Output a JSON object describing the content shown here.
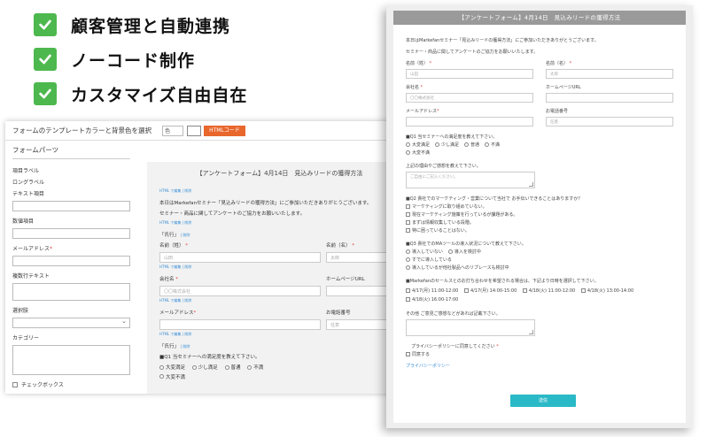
{
  "features": [
    {
      "label": "顧客管理と自動連携"
    },
    {
      "label": "ノーコード制作"
    },
    {
      "label": "カスタマイズ自由自在"
    }
  ],
  "colors": {
    "check": "#4db84d",
    "accent_orange": "#e8672c",
    "submit": "#2ab9c7",
    "header_gray": "#9a9a9a",
    "link": "#3a8fd6"
  },
  "editor": {
    "toolbar_label": "フォームのテンプレートカラーと背景色を選択",
    "color_select": "色",
    "html_button": "HTMLコード",
    "sidebar": {
      "title": "フォームパーツ",
      "items": [
        "項目ラベル",
        "ロングラベル",
        "テキスト項目",
        "数値項目",
        "メールアドレス",
        "複数行テキスト",
        "選択肢",
        "カテゴリー"
      ],
      "required_mark": "*",
      "checkbox_label": "チェックボックス"
    },
    "canvas": {
      "title": "【アンケートフォーム】4月14日　見込みリードの獲得方法",
      "link": "HTML で編集 | 削除",
      "intro1": "本日はMarkefanセミナー「見込みリードの獲得方法」にご参加いただきありがとうございます。",
      "intro2": "セミナー・商品に関してアンケートのご協力をお願いいたします。",
      "section_label": "「氏行」",
      "section_link": "| 削除",
      "last_name": "名前（姓）",
      "last_name_ph": "山田",
      "first_name": "名前（名）",
      "first_name_ph": "太郎",
      "company": "会社名",
      "company_ph": "〇〇株式会社",
      "homepage": "ホームページURL",
      "email": "メールアドレス",
      "phone": "お電話番号",
      "phone_ph": "任意",
      "section2": "「氏行」",
      "q1": "■Q1 当セミナーへの満足度を教えて下さい。",
      "q1_options": [
        "大変満足",
        "少し満足",
        "普通",
        "不満"
      ],
      "q1_last": "大変不満"
    }
  },
  "form": {
    "title": "【アンケートフォーム】4月14日　見込みリードの獲得方法",
    "intro1": "本日はMarkefanセミナー「見込みリードの獲得方法」にご参加いただきありがとうございます。",
    "intro2": "セミナー・商品に関してアンケートのご協力をお願いいたします。",
    "last_name": "名前（姓）",
    "last_name_ph": "山田",
    "first_name": "名前（名）",
    "first_name_ph": "太郎",
    "company": "会社名",
    "company_ph": "〇〇株式会社",
    "homepage": "ホームページURL",
    "email": "メールアドレス",
    "phone": "お電話番号",
    "phone_ph": "任意",
    "required_mark": "*",
    "q1": "■Q1 当セミナーへの満足度を教えて下さい。",
    "q1_options": [
      "大変満足",
      "少し満足",
      "普通",
      "不満"
    ],
    "q1_last": "大変不満",
    "q1_reason": "上記の理由やご感想を教えて下さい。",
    "q1_reason_ph": "ご自由にご記入ください。",
    "q2": "■Q2 貴社でのマーケティング・営業について当社で お手伝いできることはありますか？",
    "q2_options": [
      "マーケティングに取り組めていない。",
      "現在マーケティング施策を行っているが課題がある。",
      "まずは情報収集している段階。",
      "特に困っていることはない。"
    ],
    "q3": "■Q3 貴社でのMAツールの導入状況について教えて下さい。",
    "q3_options": [
      "導入していない",
      "導入を検討中",
      "すでに導入している",
      "導入しているが他社製品へのリプレースも検討中"
    ],
    "q4": "■Markefanのセールスとのお打ち合わせを希望される場合は、下記より日時を選択して下さい。",
    "q4_options": [
      "4/17(月) 11:00-12:00",
      "4/17(月) 14:00-15:00",
      "4/18(火) 11:00-12:00",
      "4/18(火) 13:00-14:00",
      "4/18(火) 16:00-17:00"
    ],
    "other": "その他 ご意見ご感想などがあれば記載下さい。",
    "privacy_label": "プライバシーポリシーに同意してください",
    "privacy_agree": "同意する",
    "privacy_link": "プライバシーポリシー",
    "submit": "送信"
  }
}
